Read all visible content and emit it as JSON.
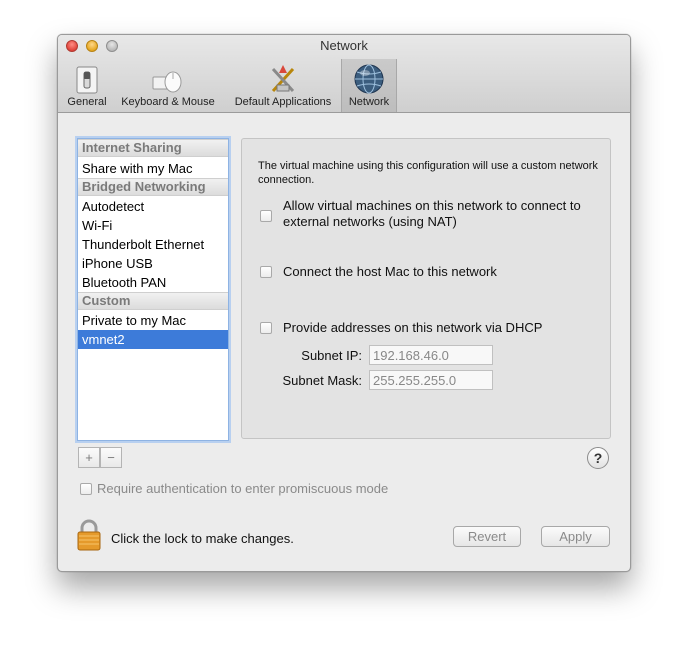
{
  "window": {
    "title": "Network"
  },
  "toolbar": {
    "items": [
      {
        "label": "General",
        "icon": "switch-icon"
      },
      {
        "label": "Keyboard & Mouse",
        "icon": "keyboard-mouse-icon"
      },
      {
        "label": "Default Applications",
        "icon": "applications-tools-icon"
      },
      {
        "label": "Network",
        "icon": "globe-network-icon",
        "selected": true
      }
    ]
  },
  "network_list": {
    "groups": [
      {
        "title": "Internet Sharing",
        "items": [
          "Share with my Mac"
        ]
      },
      {
        "title": "Bridged Networking",
        "items": [
          "Autodetect",
          "Wi-Fi",
          "Thunderbolt Ethernet",
          "iPhone USB",
          "Bluetooth PAN"
        ]
      },
      {
        "title": "Custom",
        "items": [
          "Private to my Mac",
          "vmnet2"
        ]
      }
    ],
    "selected": "vmnet2",
    "add_label": "+",
    "remove_label": "−"
  },
  "details": {
    "description": "The virtual machine using this configuration will use a custom network connection.",
    "nat_label": "Allow virtual machines on this network to connect to external networks (using NAT)",
    "host_label": "Connect the host Mac to this network",
    "dhcp_label": "Provide addresses on this network via DHCP",
    "subnet_ip_label": "Subnet IP:",
    "subnet_ip": "192.168.46.0",
    "subnet_mask_label": "Subnet Mask:",
    "subnet_mask": "255.255.255.0"
  },
  "help_label": "?",
  "promiscuous_label": "Require authentication to enter promiscuous mode",
  "lock_text": "Click the lock to make changes.",
  "revert_label": "Revert",
  "apply_label": "Apply"
}
